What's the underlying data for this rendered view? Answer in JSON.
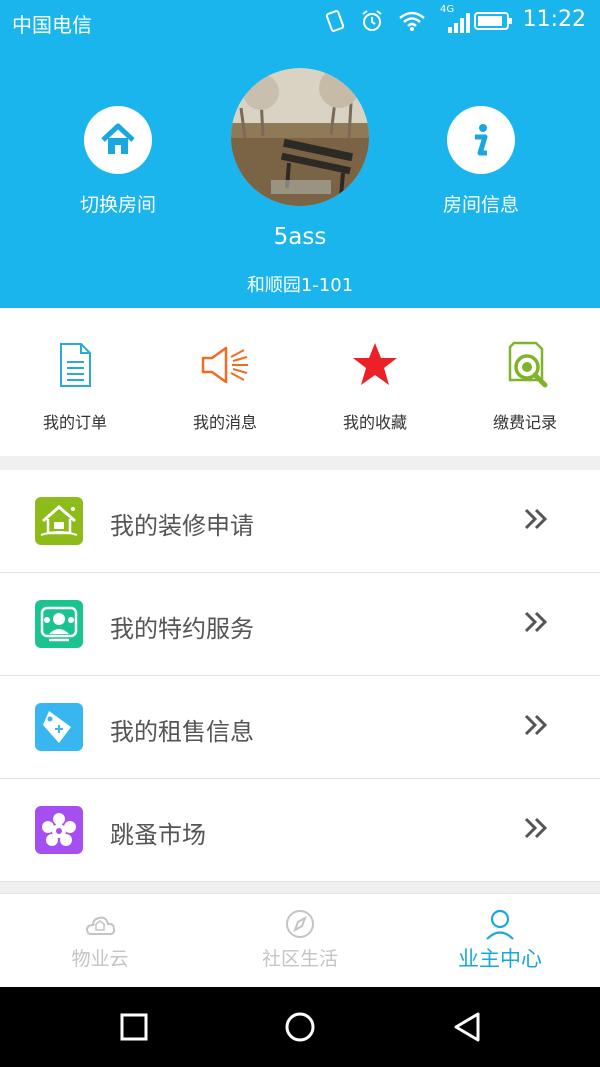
{
  "status_bar": {
    "carrier": "中国电信",
    "network": "4G",
    "time": "11:22"
  },
  "header": {
    "left_button": {
      "label": "切换房间",
      "icon": "house-icon"
    },
    "right_button": {
      "label": "房间信息",
      "icon": "info-icon"
    },
    "username": "5ass",
    "address": "和顺园1-101",
    "background": "#19b5ec"
  },
  "quick_actions": [
    {
      "label": "我的订单",
      "icon": "document-icon"
    },
    {
      "label": "我的消息",
      "icon": "speaker-icon"
    },
    {
      "label": "我的收藏",
      "icon": "star-icon"
    },
    {
      "label": "缴费记录",
      "icon": "search-document-icon"
    }
  ],
  "menu": [
    {
      "label": "我的装修申请",
      "icon": "house-renovation-icon",
      "color": "#8dbb1a"
    },
    {
      "label": "我的特约服务",
      "icon": "people-icon",
      "color": "#1bc391"
    },
    {
      "label": "我的租售信息",
      "icon": "tag-icon",
      "color": "#37b6ef"
    },
    {
      "label": "跳蚤市场",
      "icon": "flower-icon",
      "color": "#a64ff0"
    }
  ],
  "tabs": [
    {
      "label": "物业云",
      "icon": "cloud-icon",
      "active": false
    },
    {
      "label": "社区生活",
      "icon": "compass-icon",
      "active": false
    },
    {
      "label": "业主中心",
      "icon": "user-icon",
      "active": true
    }
  ]
}
